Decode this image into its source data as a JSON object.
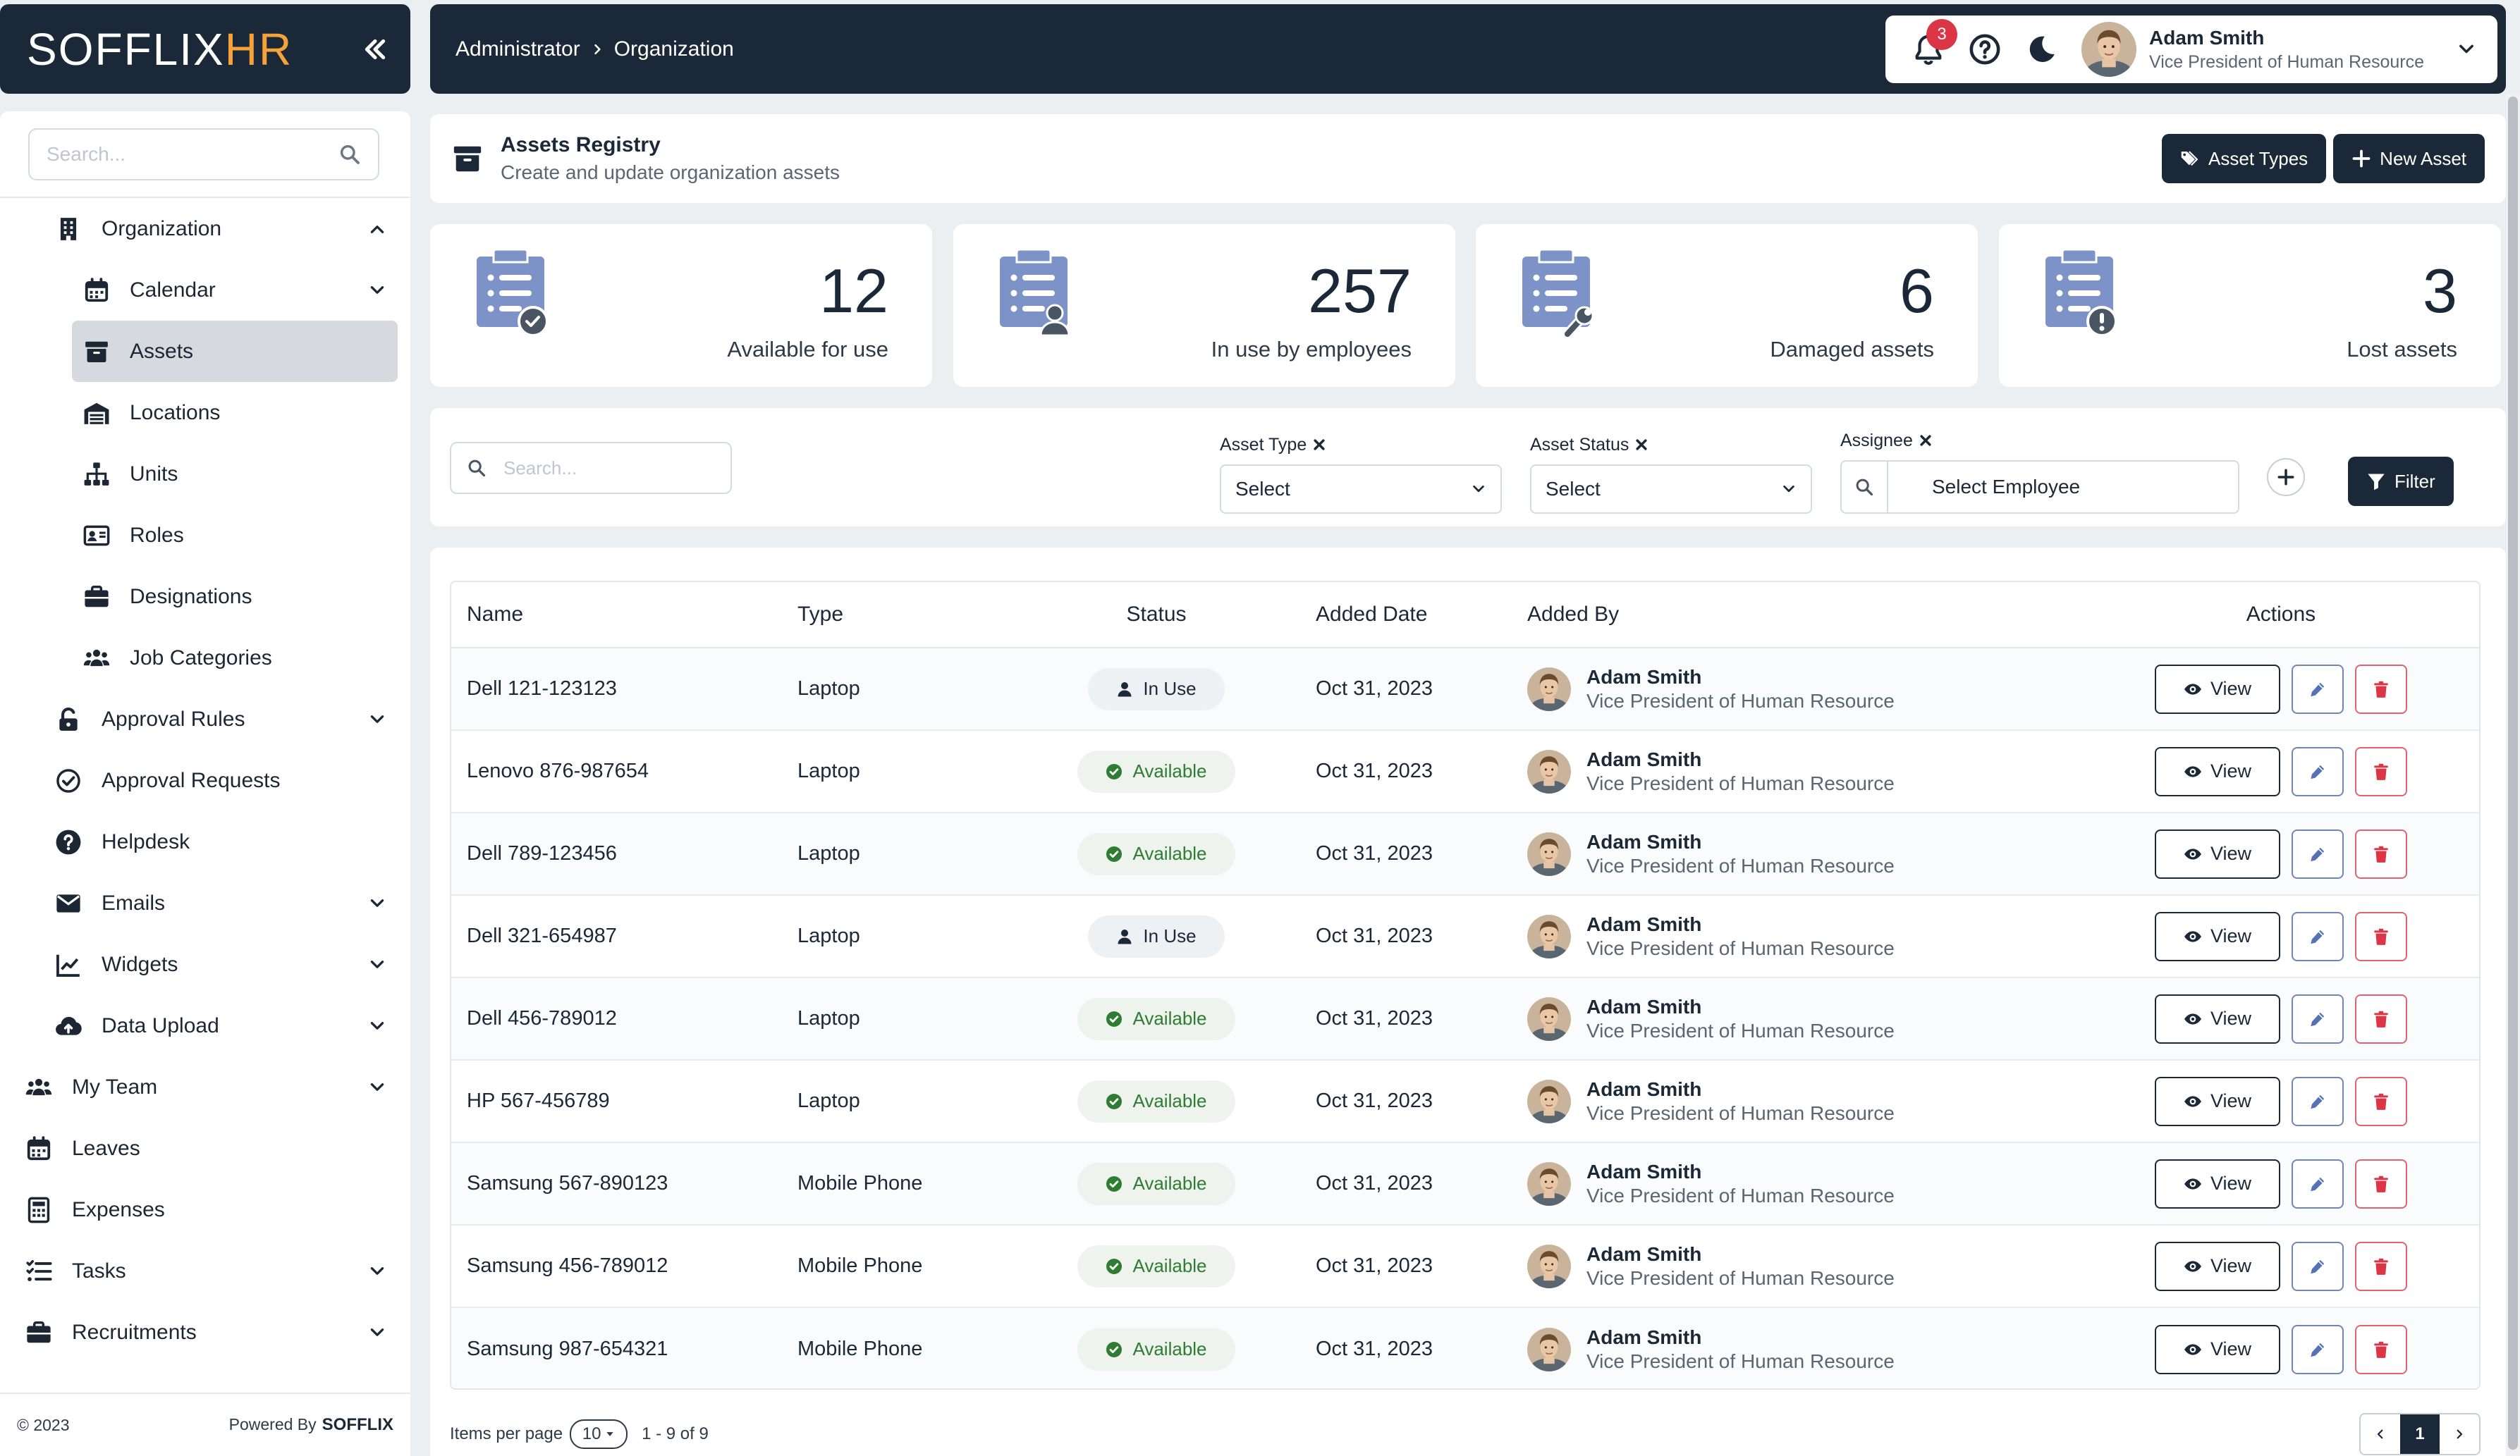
{
  "brand": {
    "logo_main": "SOFFLIX",
    "logo_accent": "HR"
  },
  "sidebar": {
    "search_placeholder": "Search...",
    "items": [
      {
        "label": "Organization",
        "level": 1,
        "icon": "building-icon",
        "expand": "up"
      },
      {
        "label": "Calendar",
        "level": 2,
        "icon": "calendar-icon",
        "expand": "down"
      },
      {
        "label": "Assets",
        "level": 2,
        "icon": "archive-icon",
        "active": true
      },
      {
        "label": "Locations",
        "level": 2,
        "icon": "warehouse-icon"
      },
      {
        "label": "Units",
        "level": 2,
        "icon": "sitemap-icon"
      },
      {
        "label": "Roles",
        "level": 2,
        "icon": "id-card-icon"
      },
      {
        "label": "Designations",
        "level": 2,
        "icon": "briefcase-icon"
      },
      {
        "label": "Job Categories",
        "level": 2,
        "icon": "users-icon"
      },
      {
        "label": "Approval Rules",
        "level": 1,
        "icon": "lock-icon",
        "expand": "down"
      },
      {
        "label": "Approval Requests",
        "level": 1,
        "icon": "check-circle-icon"
      },
      {
        "label": "Helpdesk",
        "level": 1,
        "icon": "question-circle-icon"
      },
      {
        "label": "Emails",
        "level": 1,
        "icon": "envelope-icon",
        "expand": "down"
      },
      {
        "label": "Widgets",
        "level": 1,
        "icon": "chart-line-icon",
        "expand": "down"
      },
      {
        "label": "Data Upload",
        "level": 1,
        "icon": "cloud-upload-icon",
        "expand": "down"
      },
      {
        "label": "My Team",
        "level": 0,
        "icon": "team-icon",
        "expand": "down"
      },
      {
        "label": "Leaves",
        "level": 0,
        "icon": "calendar-icon"
      },
      {
        "label": "Expenses",
        "level": 0,
        "icon": "calculator-icon"
      },
      {
        "label": "Tasks",
        "level": 0,
        "icon": "tasks-icon",
        "expand": "down"
      },
      {
        "label": "Recruitments",
        "level": 0,
        "icon": "briefcase-icon",
        "expand": "down"
      }
    ],
    "footer": {
      "copyright": "© 2023",
      "powered_by": "Powered By",
      "powered_brand": "SOFFLIX"
    }
  },
  "topbar": {
    "breadcrumb": [
      "Administrator",
      "Organization"
    ],
    "notification_count": "3",
    "user": {
      "name": "Adam Smith",
      "role": "Vice President of Human Resource"
    }
  },
  "page": {
    "title": "Assets Registry",
    "subtitle": "Create and update organization assets",
    "asset_types_label": "Asset Types",
    "new_asset_label": "New Asset"
  },
  "stats": [
    {
      "value": "12",
      "label": "Available for use",
      "icon": "clipboard-check-icon"
    },
    {
      "value": "257",
      "label": "In use by employees",
      "icon": "clipboard-user-icon"
    },
    {
      "value": "6",
      "label": "Damaged assets",
      "icon": "clipboard-wrench-icon"
    },
    {
      "value": "3",
      "label": "Lost assets",
      "icon": "clipboard-alert-icon"
    }
  ],
  "filters": {
    "search_placeholder": "Search...",
    "asset_type": {
      "label": "Asset Type",
      "value": "Select"
    },
    "asset_status": {
      "label": "Asset Status",
      "value": "Select"
    },
    "assignee": {
      "label": "Assignee",
      "value": "Select Employee"
    },
    "filter_label": "Filter"
  },
  "table": {
    "headers": {
      "name": "Name",
      "type": "Type",
      "status": "Status",
      "date": "Added Date",
      "by": "Added By",
      "actions": "Actions"
    },
    "view_label": "View",
    "rows": [
      {
        "name": "Dell 121-123123",
        "type": "Laptop",
        "status": "In Use",
        "date": "Oct 31, 2023",
        "by_name": "Adam Smith",
        "by_role": "Vice President of Human Resource"
      },
      {
        "name": "Lenovo 876-987654",
        "type": "Laptop",
        "status": "Available",
        "date": "Oct 31, 2023",
        "by_name": "Adam Smith",
        "by_role": "Vice President of Human Resource"
      },
      {
        "name": "Dell 789-123456",
        "type": "Laptop",
        "status": "Available",
        "date": "Oct 31, 2023",
        "by_name": "Adam Smith",
        "by_role": "Vice President of Human Resource"
      },
      {
        "name": "Dell 321-654987",
        "type": "Laptop",
        "status": "In Use",
        "date": "Oct 31, 2023",
        "by_name": "Adam Smith",
        "by_role": "Vice President of Human Resource"
      },
      {
        "name": "Dell 456-789012",
        "type": "Laptop",
        "status": "Available",
        "date": "Oct 31, 2023",
        "by_name": "Adam Smith",
        "by_role": "Vice President of Human Resource"
      },
      {
        "name": "HP 567-456789",
        "type": "Laptop",
        "status": "Available",
        "date": "Oct 31, 2023",
        "by_name": "Adam Smith",
        "by_role": "Vice President of Human Resource"
      },
      {
        "name": "Samsung 567-890123",
        "type": "Mobile Phone",
        "status": "Available",
        "date": "Oct 31, 2023",
        "by_name": "Adam Smith",
        "by_role": "Vice President of Human Resource"
      },
      {
        "name": "Samsung 456-789012",
        "type": "Mobile Phone",
        "status": "Available",
        "date": "Oct 31, 2023",
        "by_name": "Adam Smith",
        "by_role": "Vice President of Human Resource"
      },
      {
        "name": "Samsung 987-654321",
        "type": "Mobile Phone",
        "status": "Available",
        "date": "Oct 31, 2023",
        "by_name": "Adam Smith",
        "by_role": "Vice President of Human Resource"
      }
    ],
    "footer": {
      "items_per_page_label": "Items per page",
      "items_per_page": "10",
      "range": "1 - 9 of 9",
      "current_page": "1"
    }
  },
  "colors": {
    "navy": "#1b2837",
    "accent_orange": "#f6a23a",
    "stat_icon": "#7d93c7",
    "danger": "#dc3545",
    "success": "#2e7d32"
  }
}
